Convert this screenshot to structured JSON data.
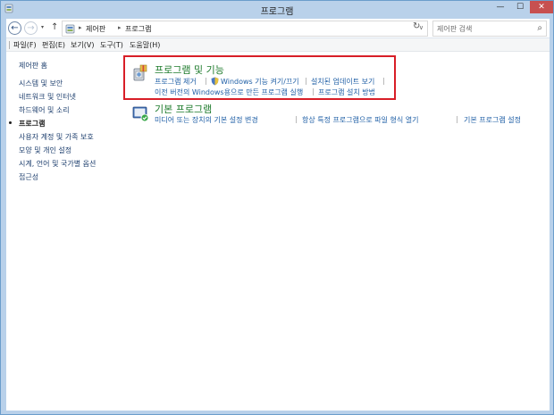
{
  "window": {
    "title": "프로그램",
    "min_glyph": "—",
    "max_glyph": "☐",
    "close_glyph": "✕"
  },
  "nav": {
    "back_glyph": "←",
    "forward_glyph": "→",
    "dropdown_glyph": "▾",
    "up_glyph": "↑",
    "breadcrumbs": [
      "제어판",
      "프로그램"
    ],
    "crumb_sep": "▸",
    "address_dropdown_glyph": "∨",
    "refresh_glyph": "↻",
    "search_placeholder": "제어판 검색",
    "search_glyph": "⌕"
  },
  "menu": {
    "items": [
      "파일(F)",
      "편집(E)",
      "보기(V)",
      "도구(T)",
      "도움말(H)"
    ]
  },
  "sidebar": {
    "items": [
      {
        "label": "제어판 홈",
        "active": false
      },
      {
        "label": "시스템 및 보안",
        "active": false
      },
      {
        "label": "네트워크 및 인터넷",
        "active": false
      },
      {
        "label": "하드웨어 및 소리",
        "active": false
      },
      {
        "label": "프로그램",
        "active": true
      },
      {
        "label": "사용자 계정 및 가족 보호",
        "active": false
      },
      {
        "label": "모양 및 개인 설정",
        "active": false
      },
      {
        "label": "시계, 언어 및 국가별 옵션",
        "active": false
      },
      {
        "label": "접근성",
        "active": false
      }
    ]
  },
  "categories": {
    "programs_features": {
      "title": "프로그램 및 기능",
      "tasks": [
        "프로그램 제거",
        "Windows 기능 켜기/끄기",
        "설치된 업데이트 보기",
        "이전 버전의 Windows용으로 만든 프로그램 실행",
        "프로그램 설치 방법"
      ]
    },
    "default_programs": {
      "title": "기본 프로그램",
      "tasks": [
        "미디어 또는 장치의 기본 설정 변경",
        "항상 특정 프로그램으로 파일 형식 열기",
        "기본 프로그램 설정"
      ]
    },
    "separator": "|"
  },
  "colors": {
    "highlight_box": "#d81e27",
    "category_title": "#1e7b2c",
    "task_link": "#1f5fa6"
  }
}
